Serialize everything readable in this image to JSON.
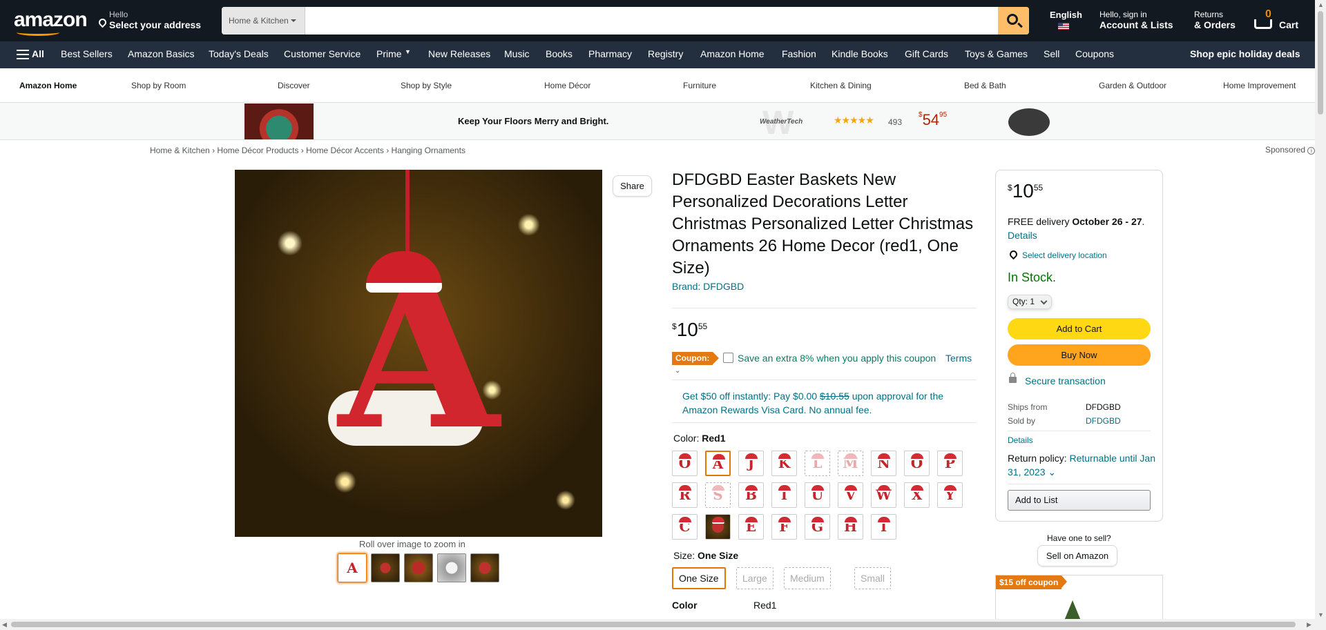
{
  "header": {
    "logo_text": "amazon",
    "deliver_hello": "Hello",
    "deliver_address": "Select your address",
    "search_category": "Home & Kitchen",
    "search_placeholder": "",
    "language": "English",
    "account_hello": "Hello, sign in",
    "account_label": "Account & Lists",
    "returns_line1": "Returns",
    "returns_line2": "& Orders",
    "cart_count": "0",
    "cart_label": "Cart"
  },
  "nav": {
    "all": "All",
    "items": [
      "Best Sellers",
      "Amazon Basics",
      "Today's Deals",
      "Customer Service",
      "Prime",
      "New Releases",
      "Music",
      "Books",
      "Pharmacy",
      "Registry",
      "Amazon Home",
      "Fashion",
      "Kindle Books",
      "Gift Cards",
      "Toys & Games",
      "Sell",
      "Coupons"
    ],
    "promo": "Shop epic holiday deals"
  },
  "subnav": [
    "Amazon Home",
    "Shop by Room",
    "Discover",
    "Shop by Style",
    "Home Décor",
    "Furniture",
    "Kitchen & Dining",
    "Bed & Bath",
    "Garden & Outdoor",
    "Home Improvement"
  ],
  "banner": {
    "tagline": "Keep Your Floors Merry and Bright.",
    "brand": "WeatherTech",
    "brand_mark": "W",
    "stars": "★★★★★",
    "rating_count": "493",
    "price_symbol": "$",
    "price_whole": "54",
    "price_fraction": "95"
  },
  "breadcrumb": [
    "Home & Kitchen",
    "Home Décor Products",
    "Home Décor Accents",
    "Hanging Ornaments"
  ],
  "breadcrumb_sep": "›",
  "sponsored": "Sponsored",
  "sponsored_info": "i",
  "gallery": {
    "share": "Share",
    "zoom_hint": "Roll over image to zoom in",
    "main_letter": "A",
    "thumb_count": 5,
    "thumb_letter": "A"
  },
  "product": {
    "title": "DFDGBD Easter Baskets New Personalized Decorations Letter Christmas Personalized Letter Christmas Ornaments 26 Home Decor (red1, One Size)",
    "brand": "Brand: DFDGBD",
    "price_symbol": "$",
    "price_whole": "10",
    "price_fraction": "55",
    "coupon_tag": "Coupon:",
    "coupon_text": "Save an extra 8% when you apply this coupon",
    "coupon_terms": "Terms",
    "coupon_chevron": "⌄",
    "promo_prefix": "Get $50 off instantly: Pay $0.00",
    "promo_strike": "$10.55",
    "promo_suffix": "upon approval for the Amazon Rewards Visa Card. No annual fee.",
    "color_key": "Color:",
    "color_value": "Red1",
    "color_swatches": [
      {
        "letter": "O",
        "state": "normal"
      },
      {
        "letter": "A",
        "state": "selected"
      },
      {
        "letter": "J",
        "state": "normal"
      },
      {
        "letter": "K",
        "state": "normal"
      },
      {
        "letter": "L",
        "state": "unavailable"
      },
      {
        "letter": "M",
        "state": "unavailable"
      },
      {
        "letter": "N",
        "state": "normal"
      },
      {
        "letter": "O",
        "state": "normal"
      },
      {
        "letter": "P",
        "state": "normal"
      },
      {
        "letter": "R",
        "state": "normal"
      },
      {
        "letter": "S",
        "state": "unavailable"
      },
      {
        "letter": "B",
        "state": "normal"
      },
      {
        "letter": "T",
        "state": "normal"
      },
      {
        "letter": "U",
        "state": "normal"
      },
      {
        "letter": "V",
        "state": "normal"
      },
      {
        "letter": "W",
        "state": "normal"
      },
      {
        "letter": "X",
        "state": "normal"
      },
      {
        "letter": "Y",
        "state": "normal"
      },
      {
        "letter": "C",
        "state": "normal"
      },
      {
        "letter": "",
        "state": "photo"
      },
      {
        "letter": "E",
        "state": "normal"
      },
      {
        "letter": "F",
        "state": "normal"
      },
      {
        "letter": "G",
        "state": "normal"
      },
      {
        "letter": "H",
        "state": "normal"
      },
      {
        "letter": "I",
        "state": "normal"
      }
    ],
    "size_key": "Size:",
    "size_value": "One Size",
    "sizes": [
      {
        "label": "One Size",
        "state": "selected"
      },
      {
        "label": "Large",
        "state": "unavailable"
      },
      {
        "label": "Medium",
        "state": "unavailable"
      },
      {
        "label": "Small",
        "state": "unavailable"
      }
    ],
    "spec_color_key": "Color",
    "spec_color_value": "Red1"
  },
  "buybox": {
    "price_symbol": "$",
    "price_whole": "10",
    "price_fraction": "55",
    "delivery_prefix": "FREE delivery",
    "delivery_dates": "October 26 - 27",
    "delivery_period": ".",
    "details": "Details",
    "location": "Select delivery location",
    "stock": "In Stock.",
    "qty_label": "Qty:",
    "qty_value": "1",
    "add_to_cart": "Add to Cart",
    "buy_now": "Buy Now",
    "secure": "Secure transaction",
    "ships_from_key": "Ships from",
    "ships_from_value": "DFDGBD",
    "sold_by_key": "Sold by",
    "sold_by_value": "DFDGBD",
    "details2": "Details",
    "return_key": "Return policy:",
    "return_value": "Returnable until Jan 31, 2023",
    "return_chevron": "⌄",
    "add_to_list": "Add to List"
  },
  "sell": {
    "question": "Have one to sell?",
    "button": "Sell on Amazon"
  },
  "ad": {
    "coupon": "$15 off coupon"
  },
  "scrollbars": {
    "up": "▲",
    "down": "▼",
    "left": "◀",
    "right": "▶"
  }
}
